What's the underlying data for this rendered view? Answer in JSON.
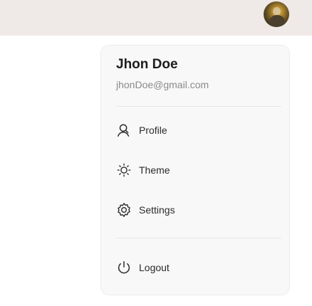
{
  "header": {
    "avatar_alt": "User avatar"
  },
  "user": {
    "name": "Jhon Doe",
    "email": "jhonDoe@gmail.com"
  },
  "menu": {
    "items": [
      {
        "label": "Profile",
        "icon": "user-icon"
      },
      {
        "label": "Theme",
        "icon": "sun-icon"
      },
      {
        "label": "Settings",
        "icon": "gear-icon"
      }
    ],
    "logout": {
      "label": "Logout",
      "icon": "power-icon"
    }
  },
  "colors": {
    "topbar": "#efe9e7",
    "menu_bg": "#f8f8f8",
    "text": "#2a2a2a",
    "muted": "#8a8a8a"
  }
}
